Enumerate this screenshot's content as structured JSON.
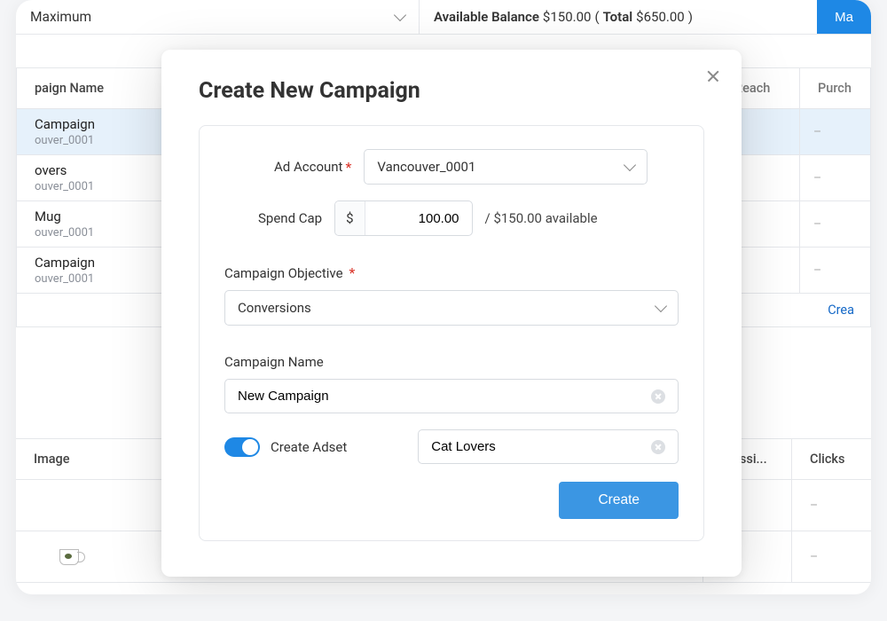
{
  "topbar": {
    "select_value": "Maximum",
    "balance_label": "Available Balance",
    "balance_amount": "$150.00",
    "total_label": "Total",
    "total_amount": "$650.00",
    "max_button": "Ma"
  },
  "table1": {
    "headers": {
      "name": "paign Name",
      "reach": "Reach",
      "purchases": "Purch"
    },
    "rows": [
      {
        "title": "Campaign",
        "subtitle": "ouver_0001",
        "selected": true
      },
      {
        "title": "overs",
        "subtitle": "ouver_0001",
        "selected": false
      },
      {
        "title": "Mug",
        "subtitle": "ouver_0001",
        "selected": false
      },
      {
        "title": "Campaign",
        "subtitle": "ouver_0001",
        "selected": false
      }
    ],
    "create_link": "Crea"
  },
  "table2": {
    "headers": {
      "image": "Image",
      "impressions": "pressi...",
      "clicks": "Clicks"
    }
  },
  "dash": "–",
  "modal": {
    "title": "Create New Campaign",
    "ad_account_label": "Ad Account",
    "ad_account_value": "Vancouver_0001",
    "spend_cap_label": "Spend Cap",
    "currency_symbol": "$",
    "spend_cap_value": "100.00",
    "available_text": "/ $150.00 available",
    "objective_label": "Campaign Objective",
    "objective_value": "Conversions",
    "name_label": "Campaign Name",
    "name_value": "New Campaign",
    "create_adset_label": "Create Adset",
    "adset_value": "Cat Lovers",
    "create_button": "Create",
    "asterisk": "*"
  }
}
